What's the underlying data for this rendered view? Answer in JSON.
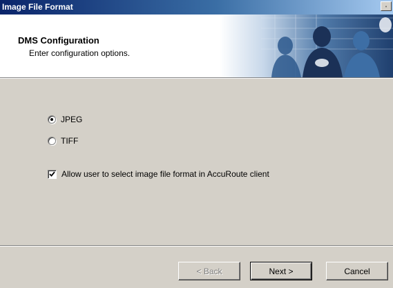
{
  "window": {
    "title": "Image File Format"
  },
  "header": {
    "title": "DMS Configuration",
    "subtitle": "Enter configuration options."
  },
  "options": {
    "format": [
      {
        "label": "JPEG",
        "selected": true
      },
      {
        "label": "TIFF",
        "selected": false
      }
    ],
    "allow_user_select": {
      "label": "Allow user to select image file format in AccuRoute client",
      "checked": true
    }
  },
  "buttons": {
    "back": "< Back",
    "next": "Next >",
    "cancel": "Cancel"
  },
  "icons": {
    "close": "close-icon",
    "check": "check-icon"
  },
  "colors": {
    "titlebar_start": "#0a246a",
    "titlebar_end": "#a6caf0",
    "dialog_bg": "#d4d0c8",
    "banner_blue": "#2e5a8e"
  }
}
